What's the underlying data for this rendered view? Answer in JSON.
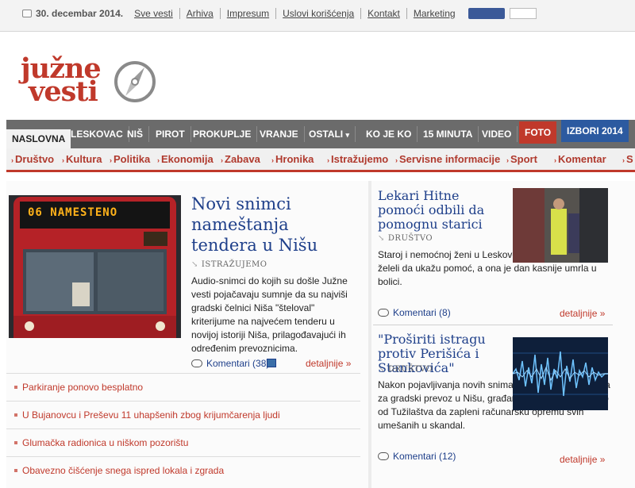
{
  "topbar": {
    "date": "30. decembar 2014.",
    "links": [
      "Sve vesti",
      "Arhiva",
      "Impresum",
      "Uslovi korišćenja",
      "Kontakt",
      "Marketing"
    ]
  },
  "logo": {
    "line1": "južne",
    "line2": "vesti"
  },
  "nav": {
    "items": [
      "NASLOVNA",
      "LESKOVAC",
      "NIŠ",
      "PIROT",
      "PROKUPLJE",
      "VRANJE",
      "OSTALI",
      "KO JE KO",
      "15 MINUTA",
      "VIDEO",
      "FOTO",
      "IZBORI 2014"
    ],
    "dropdown_caret": "▾"
  },
  "subnav": {
    "items": [
      "Društvo",
      "Kultura",
      "Politika",
      "Ekonomija",
      "Zabava",
      "Hronika",
      "Istražujemo",
      "Servisne informacije",
      "Sport",
      "Komentar",
      "S"
    ]
  },
  "featured": {
    "bus_sign": "06 NAMESTENO",
    "title": "Novi snimci nameštanja tendera u Nišu",
    "category": "ISTRAŽUJEMO",
    "lead": "Audio-snimci do kojih su došle Južne vesti pojačavaju sumnje da su najviši gradski čelnici Niša \"šteloval\" kriterijume na najvećem tenderu u novijoj istoriji Niša, prilagođavajući ih određenim prevoznicima.",
    "comments": "Komentari (38)",
    "more": "detaljnije »"
  },
  "headlines": [
    "Parkiranje ponovo besplatno",
    "U Bujanovcu i Preševu 11 uhapšenih zbog krijumčarenja ljudi",
    "Glumačka radionica u niškom pozorištu",
    "Obavezno čišćenje snega ispred lokala i zgrada"
  ],
  "side_articles": [
    {
      "title": "Lekari Hitne pomoći odbili da pomognu starici",
      "category": "DRUŠTVO",
      "lead": "Staroj i nemoćnoj ženi u Leskovcu lekari Hitne nisu želeli da ukažu pomoć, a ona je dan kasnije umrla u bolici.",
      "comments": "Komentari (8)",
      "more": "detaljnije »"
    },
    {
      "title": "\"Proširiti istragu protiv Perišića i Stankovića\"",
      "category": "DRUŠTVO",
      "lead": "Nakon pojavljivanja novih snimaka nameštanja tendera za gradski prevoz u Nišu, građanski nadzornik zatražio od Tužilaštva da zapleni računarsku opremu svih umešanih u skandal.",
      "comments": "Komentari (12)",
      "more": "detaljnije »"
    }
  ],
  "colors": {
    "brand_red": "#c0392b",
    "link_blue": "#1e3f8a",
    "nav_gray": "#6b6b6b",
    "izbori_blue": "#2c5aa0"
  }
}
